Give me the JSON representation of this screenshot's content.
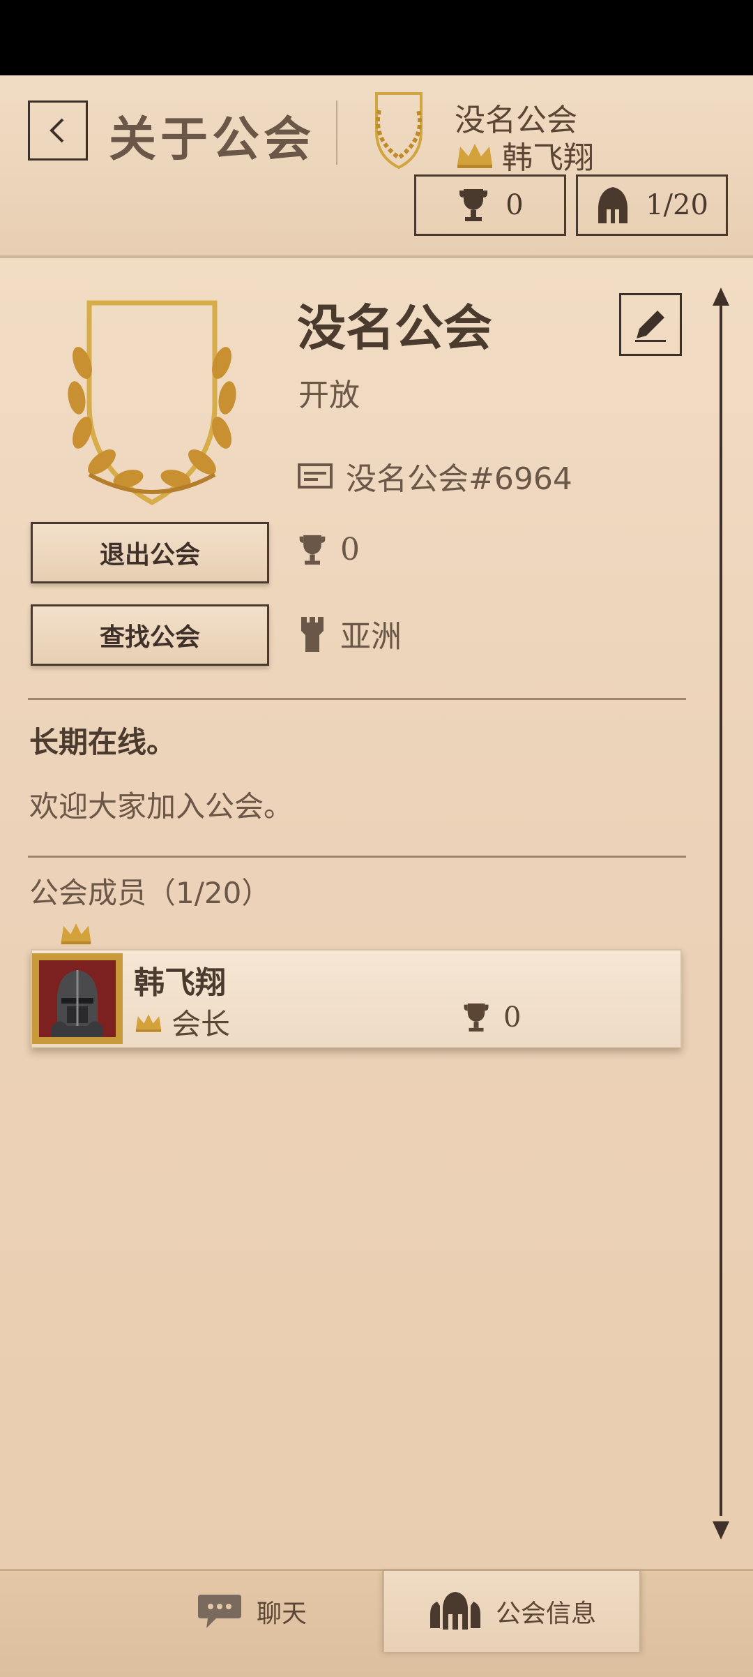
{
  "header": {
    "back_icon": "chevron-left-icon",
    "title": "关于公会",
    "guild_name": "没名公会",
    "leader_name": "韩飞翔",
    "trophies": "0",
    "member_count": "1/20"
  },
  "guild": {
    "name": "没名公会",
    "status": "开放",
    "tag": "没名公会#6964",
    "trophies": "0",
    "region": "亚洲",
    "leave_button": "退出公会",
    "search_button": "查找公会"
  },
  "description": {
    "line1": "长期在线。",
    "line2": "欢迎大家加入公会。"
  },
  "members": {
    "title": "公会成员（1/20）",
    "items": [
      {
        "name": "韩飞翔",
        "role": "会长",
        "trophies": "0"
      }
    ]
  },
  "nav": {
    "chat_label": "聊天",
    "guild_info_label": "公会信息"
  },
  "colors": {
    "parchment": "#e9cfb2",
    "text_dark": "#4b3a2e",
    "gold": "#c99a3a",
    "avatar_bg": "#7d2020"
  }
}
